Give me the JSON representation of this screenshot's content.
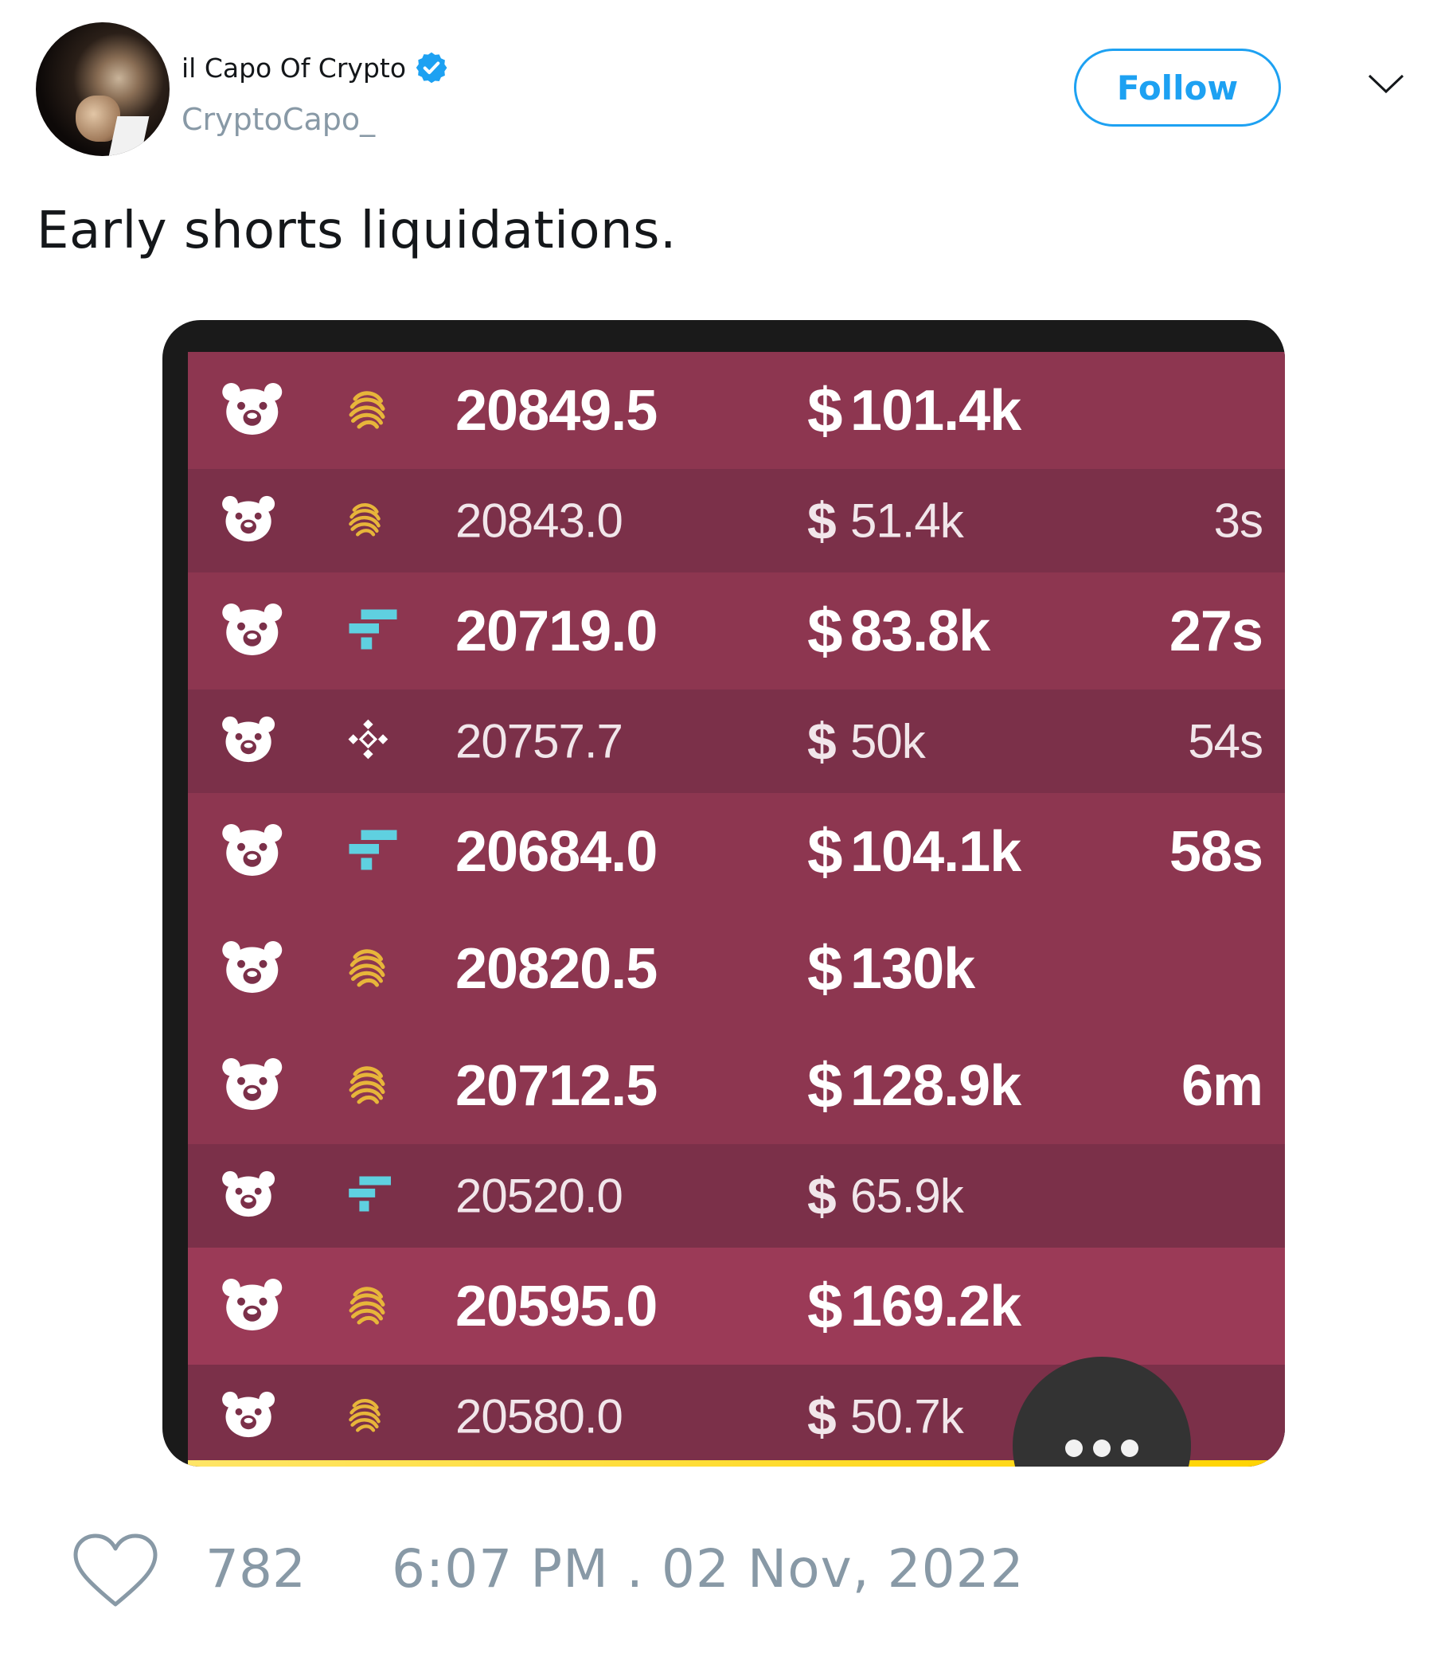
{
  "tweet": {
    "display_name": "il Capo Of Crypto",
    "handle": "CryptoCapo_",
    "verified_icon": "verified-badge-icon",
    "follow_label": "Follow",
    "text": "Early shorts liquidations.",
    "likes": "782",
    "timestamp": "6:07 PM . 02 Nov, 2022"
  },
  "colors": {
    "accent": "#1da1f2",
    "muted": "#8899a6",
    "row_big": "#8d3650",
    "row_small": "#7b3049",
    "row_hot": "#9b3a57"
  },
  "liquidations": [
    {
      "exchange_icon": "sun-exchange-icon",
      "price": "20849.5",
      "currency": "$",
      "amount": "101.4k",
      "age": "",
      "size": "big"
    },
    {
      "exchange_icon": "sun-exchange-icon",
      "price": "20843.0",
      "currency": "$",
      "amount": "51.4k",
      "age": "3s",
      "size": "small"
    },
    {
      "exchange_icon": "ftx-icon",
      "price": "20719.0",
      "currency": "$",
      "amount": "83.8k",
      "age": "27s",
      "size": "big"
    },
    {
      "exchange_icon": "binance-icon",
      "price": "20757.7",
      "currency": "$",
      "amount": "50k",
      "age": "54s",
      "size": "small"
    },
    {
      "exchange_icon": "ftx-icon",
      "price": "20684.0",
      "currency": "$",
      "amount": "104.1k",
      "age": "58s",
      "size": "big"
    },
    {
      "exchange_icon": "sun-exchange-icon",
      "price": "20820.5",
      "currency": "$",
      "amount": "130k",
      "age": "",
      "size": "big"
    },
    {
      "exchange_icon": "sun-exchange-icon",
      "price": "20712.5",
      "currency": "$",
      "amount": "128.9k",
      "age": "6m",
      "size": "big"
    },
    {
      "exchange_icon": "ftx-icon",
      "price": "20520.0",
      "currency": "$",
      "amount": "65.9k",
      "age": "",
      "size": "small"
    },
    {
      "exchange_icon": "sun-exchange-icon",
      "price": "20595.0",
      "currency": "$",
      "amount": "169.2k",
      "age": "",
      "size": "hot"
    },
    {
      "exchange_icon": "sun-exchange-icon",
      "price": "20580.0",
      "currency": "$",
      "amount": "50.7k",
      "age": "",
      "size": "small"
    }
  ],
  "more_button_icon": "more-dots-icon"
}
